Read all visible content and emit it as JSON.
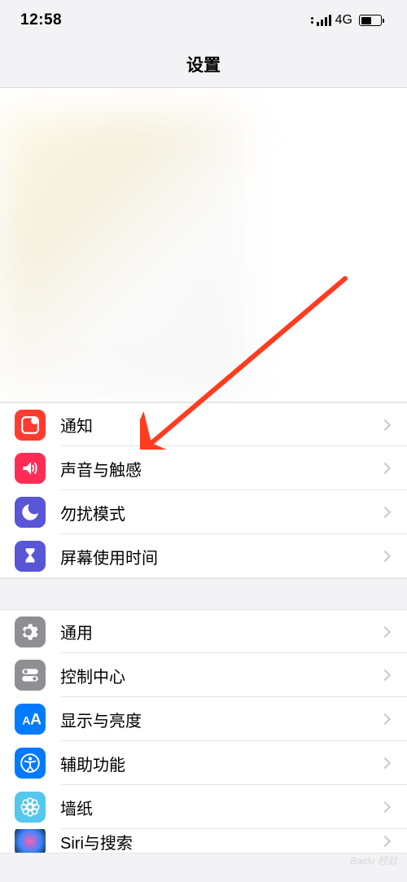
{
  "status_bar": {
    "time": "12:58",
    "network_label": "4G"
  },
  "header": {
    "title": "设置"
  },
  "group1": {
    "items": [
      {
        "label": "通知",
        "icon": "notifications"
      },
      {
        "label": "声音与触感",
        "icon": "sounds"
      },
      {
        "label": "勿扰模式",
        "icon": "dnd"
      },
      {
        "label": "屏幕使用时间",
        "icon": "screentime"
      }
    ]
  },
  "group2": {
    "items": [
      {
        "label": "通用",
        "icon": "general"
      },
      {
        "label": "控制中心",
        "icon": "control"
      },
      {
        "label": "显示与亮度",
        "icon": "display"
      },
      {
        "label": "辅助功能",
        "icon": "accessibility"
      },
      {
        "label": "墙纸",
        "icon": "wallpaper"
      },
      {
        "label": "Siri与搜索",
        "icon": "siri"
      }
    ]
  },
  "annotation": {
    "arrow_color": "#ff3c1f"
  },
  "watermark": "Baidu 经验"
}
